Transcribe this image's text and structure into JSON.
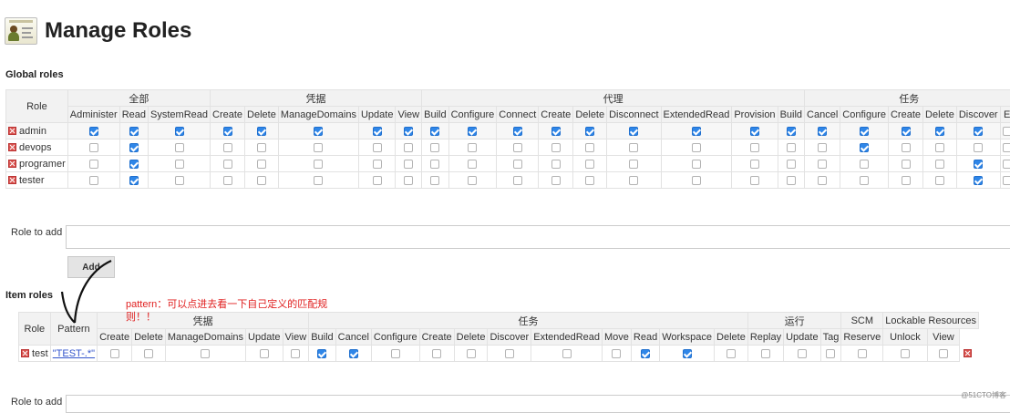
{
  "header": {
    "title": "Manage Roles"
  },
  "global": {
    "section_title": "Global roles",
    "role_header": "Role",
    "groups": [
      {
        "label": "全部",
        "span": 3
      },
      {
        "label": "凭据",
        "span": 5
      },
      {
        "label": "代理",
        "span": 9
      },
      {
        "label": "任务",
        "span": 8
      }
    ],
    "permissions": [
      "Administer",
      "Read",
      "SystemRead",
      "Create",
      "Delete",
      "ManageDomains",
      "Update",
      "View",
      "Build",
      "Configure",
      "Connect",
      "Create",
      "Delete",
      "Disconnect",
      "ExtendedRead",
      "Provision",
      "Build",
      "Cancel",
      "Configure",
      "Create",
      "Delete",
      "Discover",
      "E"
    ],
    "rows": [
      {
        "name": "admin",
        "checks": [
          1,
          1,
          1,
          1,
          1,
          1,
          1,
          1,
          1,
          1,
          1,
          1,
          1,
          1,
          1,
          1,
          1,
          1,
          1,
          1,
          1,
          1,
          0
        ]
      },
      {
        "name": "devops",
        "checks": [
          0,
          1,
          0,
          0,
          0,
          0,
          0,
          0,
          0,
          0,
          0,
          0,
          0,
          0,
          0,
          0,
          0,
          0,
          1,
          0,
          0,
          0,
          0
        ]
      },
      {
        "name": "programer",
        "checks": [
          0,
          1,
          0,
          0,
          0,
          0,
          0,
          0,
          0,
          0,
          0,
          0,
          0,
          0,
          0,
          0,
          0,
          0,
          0,
          0,
          0,
          1,
          0
        ]
      },
      {
        "name": "tester",
        "checks": [
          0,
          1,
          0,
          0,
          0,
          0,
          0,
          0,
          0,
          0,
          0,
          0,
          0,
          0,
          0,
          0,
          0,
          0,
          0,
          0,
          0,
          1,
          0
        ]
      }
    ],
    "role_to_add_label": "Role to add",
    "role_to_add_value": "",
    "add_button": "Add"
  },
  "item": {
    "section_title": "Item roles",
    "role_header": "Role",
    "pattern_header": "Pattern",
    "groups": [
      {
        "label": "凭据",
        "span": 5
      },
      {
        "label": "任务",
        "span": 11
      },
      {
        "label": "运行",
        "span": 3
      },
      {
        "label": "SCM",
        "span": 1
      },
      {
        "label": "Lockable Resources",
        "span": 3
      }
    ],
    "permissions": [
      "Create",
      "Delete",
      "ManageDomains",
      "Update",
      "View",
      "Build",
      "Cancel",
      "Configure",
      "Create",
      "Delete",
      "Discover",
      "ExtendedRead",
      "Move",
      "Read",
      "Workspace",
      "Delete",
      "Replay",
      "Update",
      "Tag",
      "Reserve",
      "Unlock",
      "View"
    ],
    "rows": [
      {
        "name": "test",
        "pattern": "\"TEST-.*\"",
        "checks": [
          0,
          0,
          0,
          0,
          0,
          1,
          1,
          0,
          0,
          0,
          0,
          0,
          0,
          1,
          1,
          0,
          0,
          0,
          0,
          0,
          0,
          0
        ]
      }
    ],
    "role_to_add_label": "Role to add"
  },
  "annotation": {
    "text": "pattern：可以点进去看一下自己定义的匹配规则！！"
  },
  "watermark": "@51CTO博客"
}
